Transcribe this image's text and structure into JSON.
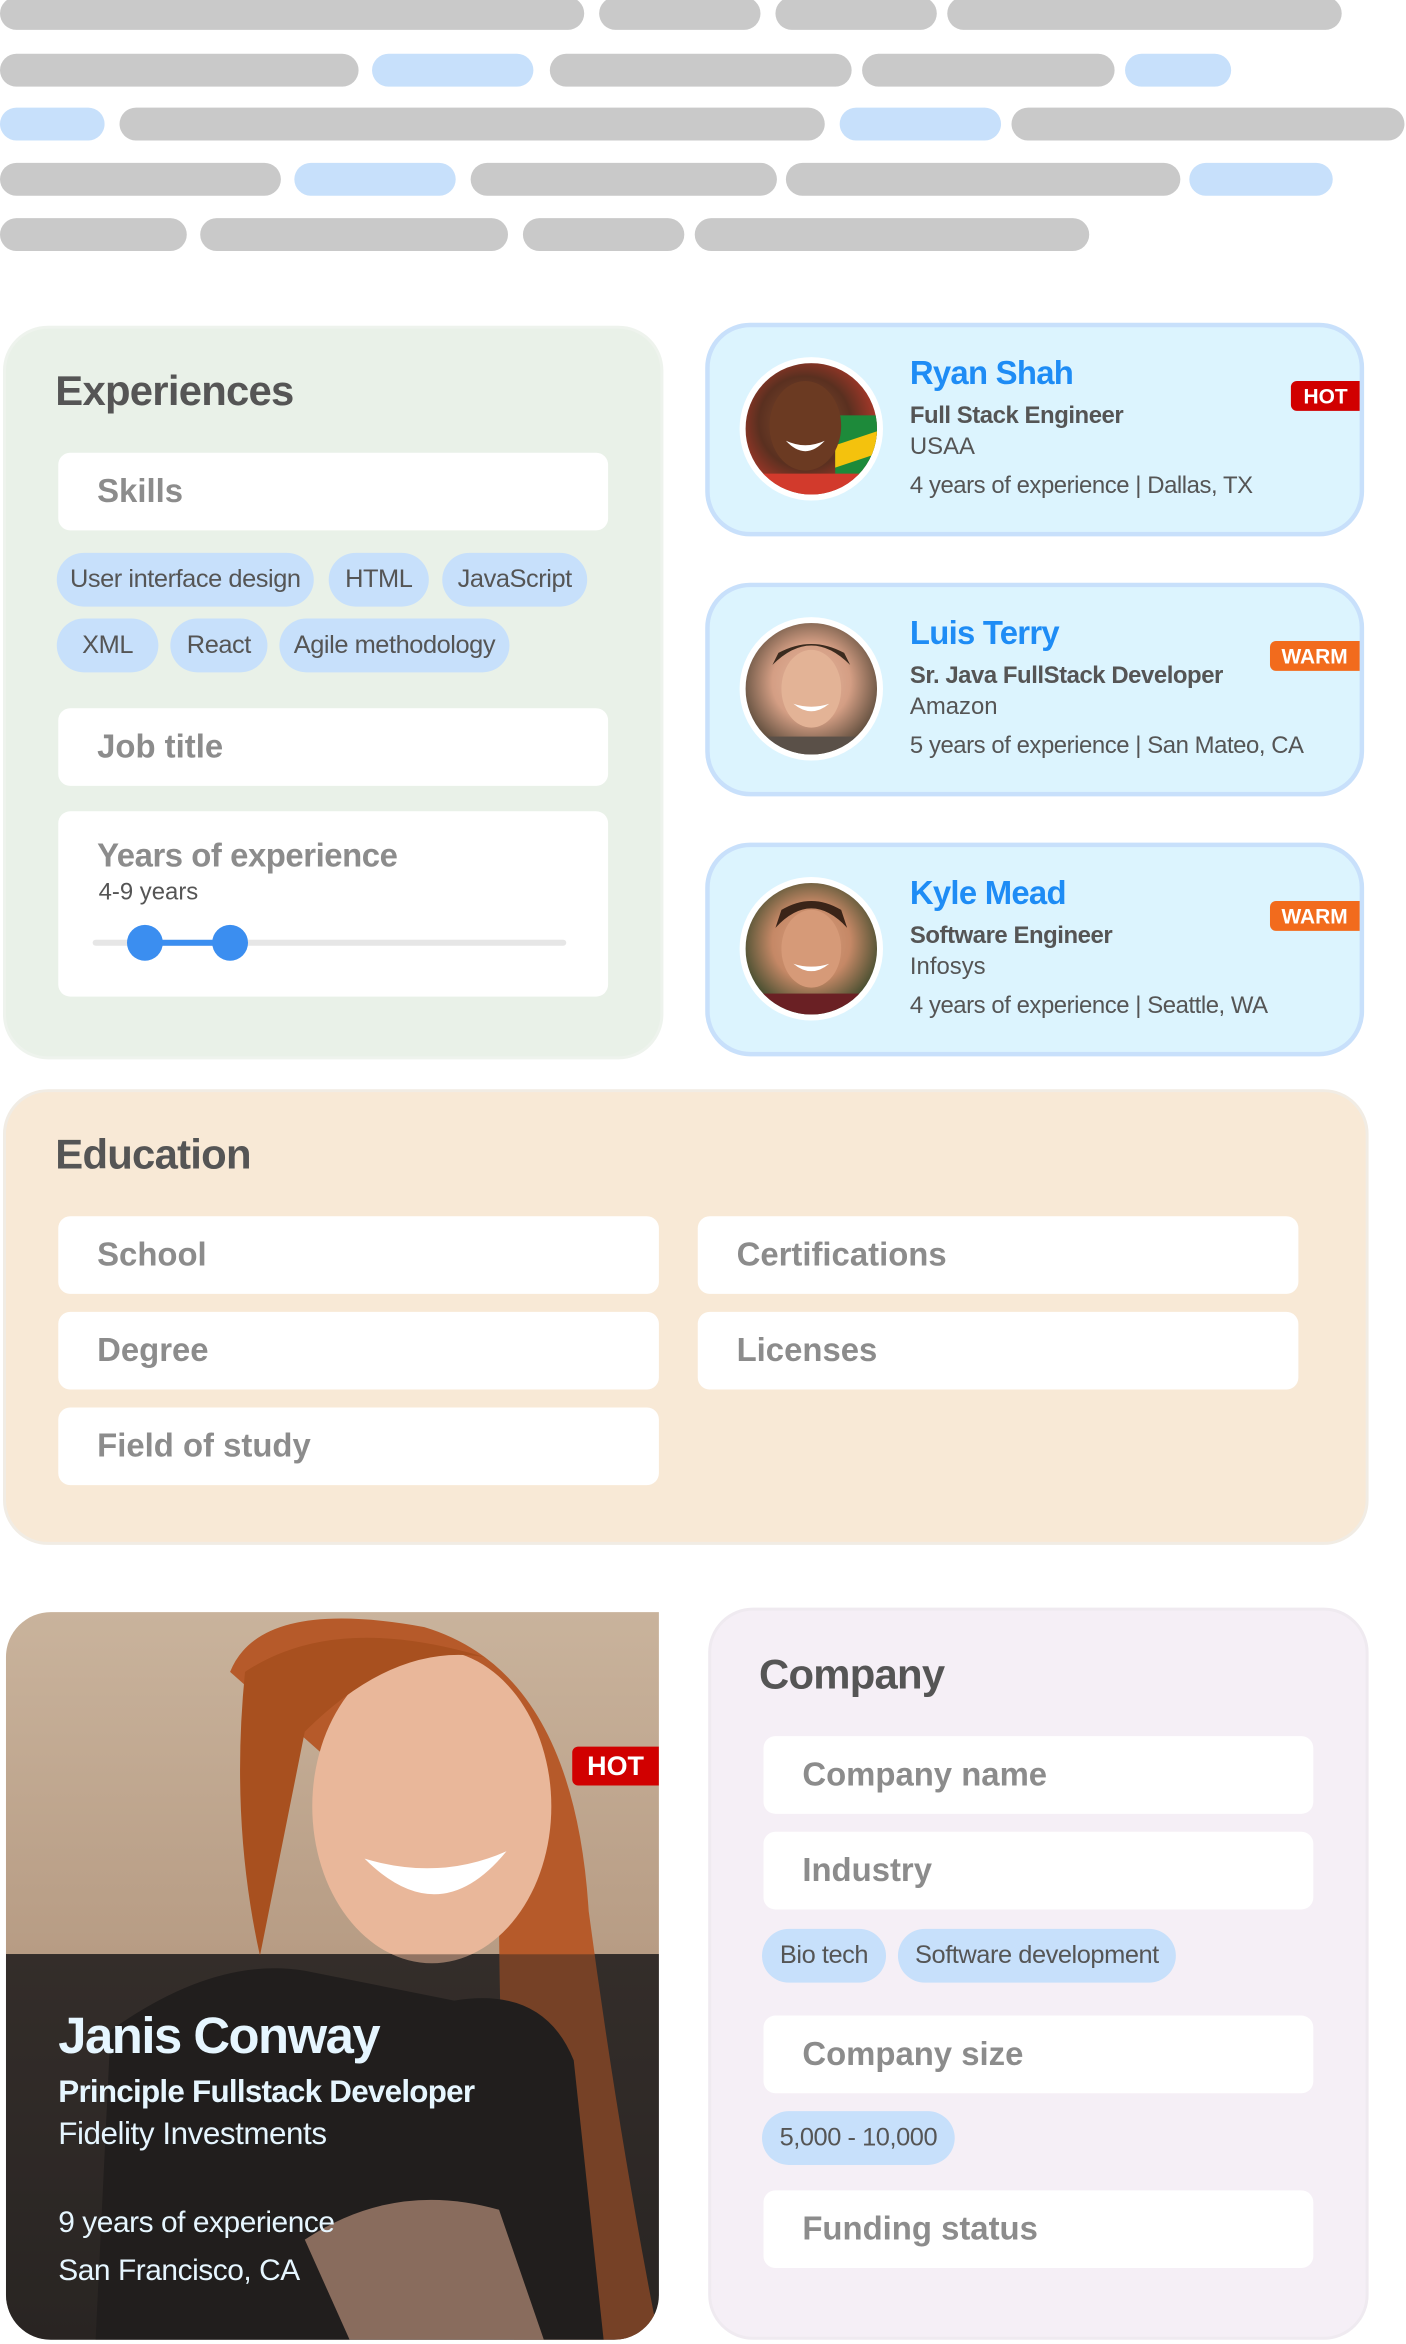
{
  "colors": {
    "accent_blue": "#1e8cf5",
    "hot": "#d10000",
    "warm": "#f26b1d",
    "chip": "#c7e0fb",
    "experiences_bg": "#e9f1e8",
    "education_bg": "#f8e9d6",
    "company_bg": "#f5eff6",
    "card_bg": "#dcf4fe"
  },
  "experiences": {
    "title": "Experiences",
    "skills_placeholder": "Skills",
    "skill_chips": [
      "User interface design",
      "HTML",
      "JavaScript",
      "XML",
      "React",
      "Agile methodology"
    ],
    "job_title_placeholder": "Job title",
    "years_label": "Years of experience",
    "years_value": "4-9 years",
    "years_range": [
      4,
      9
    ]
  },
  "candidates": [
    {
      "name": "Ryan Shah",
      "title": "Full Stack Engineer",
      "company": "USAA",
      "experience": "4 years of experience",
      "location": "Dallas, TX",
      "badge": "HOT"
    },
    {
      "name": "Luis Terry",
      "title": "Sr. Java FullStack Developer",
      "company": "Amazon",
      "experience": "5 years of experience",
      "location": "San Mateo, CA",
      "badge": "WARM"
    },
    {
      "name": "Kyle Mead",
      "title": "Software Engineer",
      "company": "Infosys",
      "experience": "4 years of experience",
      "location": "Seattle, WA",
      "badge": "WARM"
    }
  ],
  "separator": "|",
  "education": {
    "title": "Education",
    "school": "School",
    "degree": "Degree",
    "field_of_study": "Field of study",
    "certifications": "Certifications",
    "licenses": "Licenses"
  },
  "featured": {
    "name": "Janis Conway",
    "title": "Principle Fullstack Developer",
    "company": "Fidelity Investments",
    "experience": "9 years of experience",
    "location": "San Francisco, CA",
    "badge": "HOT"
  },
  "company": {
    "title": "Company",
    "company_name": "Company name",
    "industry": "Industry",
    "industry_chips": [
      "Bio tech",
      "Software development"
    ],
    "company_size": "Company size",
    "size_chip": "5,000 - 10,000",
    "funding_status": "Funding status"
  }
}
